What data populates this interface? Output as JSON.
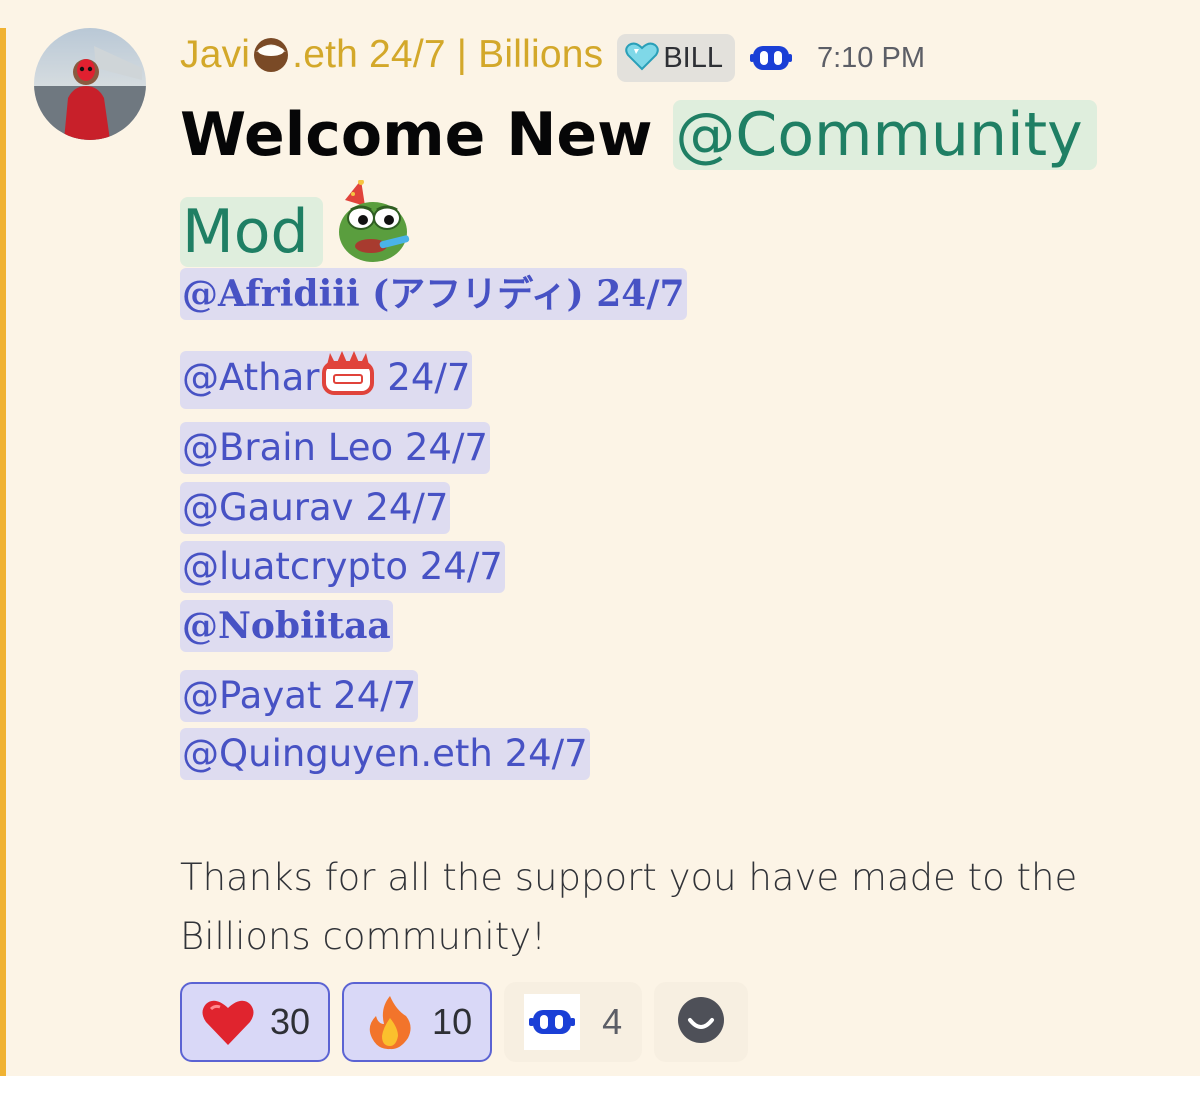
{
  "message": {
    "author": {
      "name_prefix": "Javi",
      "name_suffix": ".eth 24/7 | Billions"
    },
    "server_tag": {
      "label": "BILL"
    },
    "timestamp": "7:10 PM",
    "heading": {
      "text": "Welcome New ",
      "role_mention": "@Community Mod"
    },
    "mentions": [
      {
        "text": "@Afridiii (アフリディ) 24/7"
      },
      {
        "text": "@Athar",
        "suffix": " 24/7"
      },
      {
        "text": "@Brain Leo 24/7"
      },
      {
        "text": "@Gaurav 24/7"
      },
      {
        "text": "@luatcrypto 24/7"
      },
      {
        "text": "@Nobiitaa"
      },
      {
        "text": "@Payat 24/7"
      },
      {
        "text": "@Quinguyen.eth 24/7"
      }
    ],
    "body": "Thanks for all the support you have made to the Billions community!",
    "reactions": [
      {
        "emoji": "heart",
        "count": "30",
        "reacted": true
      },
      {
        "emoji": "fire",
        "count": "10",
        "reacted": true
      },
      {
        "emoji": "billions-bot",
        "count": "4",
        "reacted": false
      }
    ]
  },
  "colors": {
    "background": "#fcf4e6",
    "accent_bar": "#f0b232",
    "username": "#d3a82a",
    "role_mention_text": "#1f7f64",
    "role_mention_bg": "#dfeedd",
    "mention_text": "#4752c4",
    "mention_bg": "#dedcf0",
    "reaction_active_border": "#5b63d3"
  },
  "icons": [
    "coconut-emoji",
    "heart-gem-icon",
    "billions-bot-icon",
    "pepe-party-emoji",
    "fire-box-emoji",
    "heart-emoji",
    "fire-emoji",
    "add-reaction-icon"
  ]
}
